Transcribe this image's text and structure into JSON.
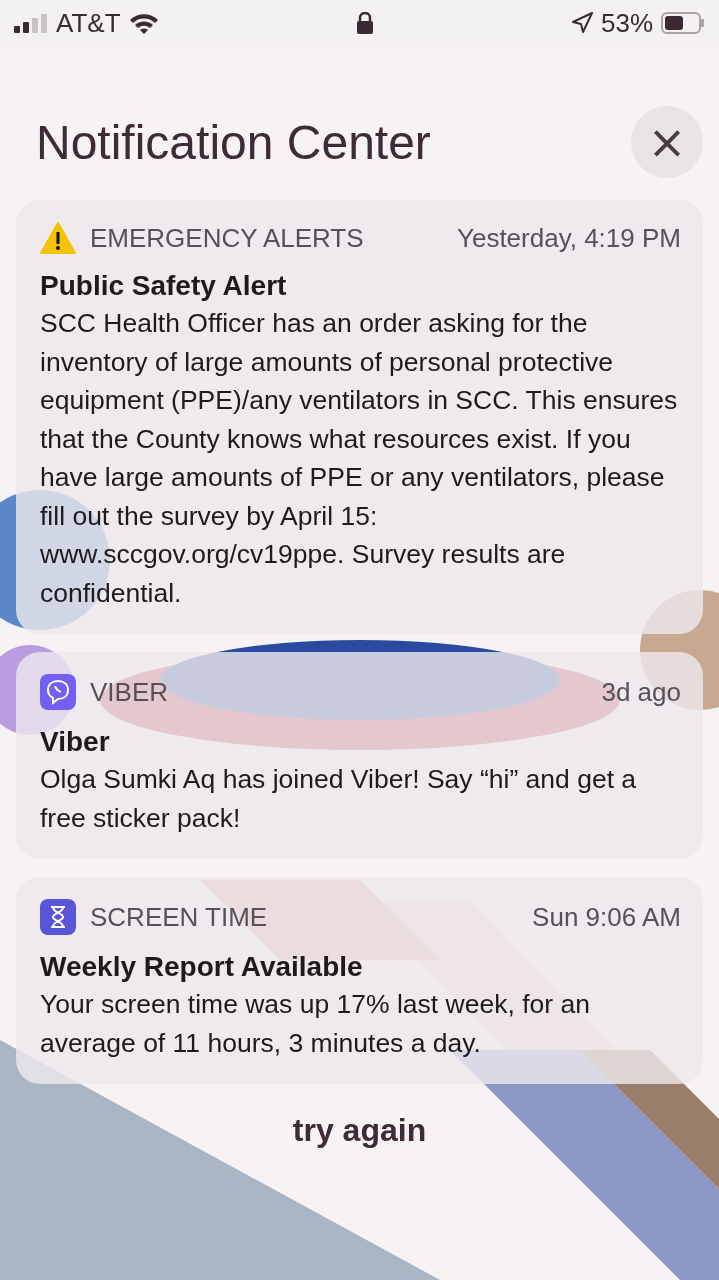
{
  "status_bar": {
    "carrier": "AT&T",
    "battery": "53%"
  },
  "header": {
    "title": "Notification Center",
    "close": "×"
  },
  "notifications": [
    {
      "kind": "warning",
      "app": "EMERGENCY ALERTS",
      "time": "Yesterday, 4:19 PM",
      "title": "Public Safety Alert",
      "body": "SCC Health Officer has an order asking for the inventory of large amounts of personal protective equipment (PPE)/any ventilators in SCC. This ensures that the County knows what resources exist. If you have large amounts of PPE or any ventilators, please fill out the survey by April 15: www.sccgov.org/cv19ppe. Survey results are confidential."
    },
    {
      "kind": "viber",
      "app": "VIBER",
      "time": "3d ago",
      "title": "Viber",
      "body": "Olga Sumki Aq has joined Viber! Say “hi” and get a free sticker pack!"
    },
    {
      "kind": "screentime",
      "app": "SCREEN TIME",
      "time": "Sun 9:06 AM",
      "title": "Weekly Report Available",
      "body": "Your screen time was up 17% last week, for an average of 11 hours, 3 minutes a day."
    }
  ],
  "footer": {
    "text": "try again"
  }
}
